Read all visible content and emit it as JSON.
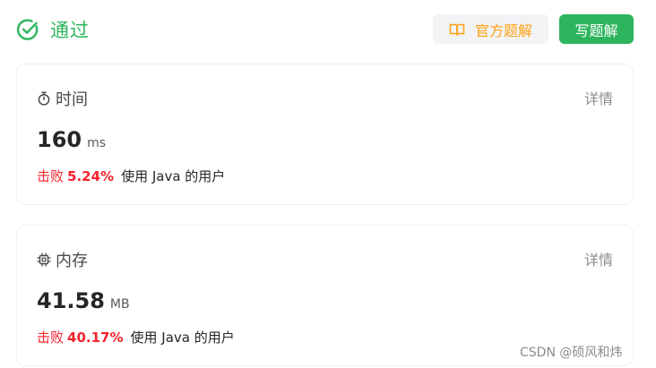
{
  "header": {
    "status_text": "通过",
    "status_icon": "check-circle-icon",
    "official_solution_label": "官方题解",
    "official_solution_icon": "book-icon",
    "write_solution_label": "写题解"
  },
  "time_card": {
    "icon": "stopwatch-icon",
    "title": "时间",
    "detail_label": "详情",
    "value": "160",
    "unit": "ms",
    "beat_label": "击败",
    "beat_percent": "5.24%",
    "beat_suffix": "使用 Java 的用户"
  },
  "memory_card": {
    "icon": "chip-icon",
    "title": "内存",
    "detail_label": "详情",
    "value": "41.58",
    "unit": "MB",
    "beat_label": "击败",
    "beat_percent": "40.17%",
    "beat_suffix": "使用 Java 的用户"
  },
  "watermark": "CSDN @硕风和炜",
  "colors": {
    "accent_green": "#2db55d",
    "official_orange": "#ffa116",
    "beat_red": "#f5222d"
  }
}
